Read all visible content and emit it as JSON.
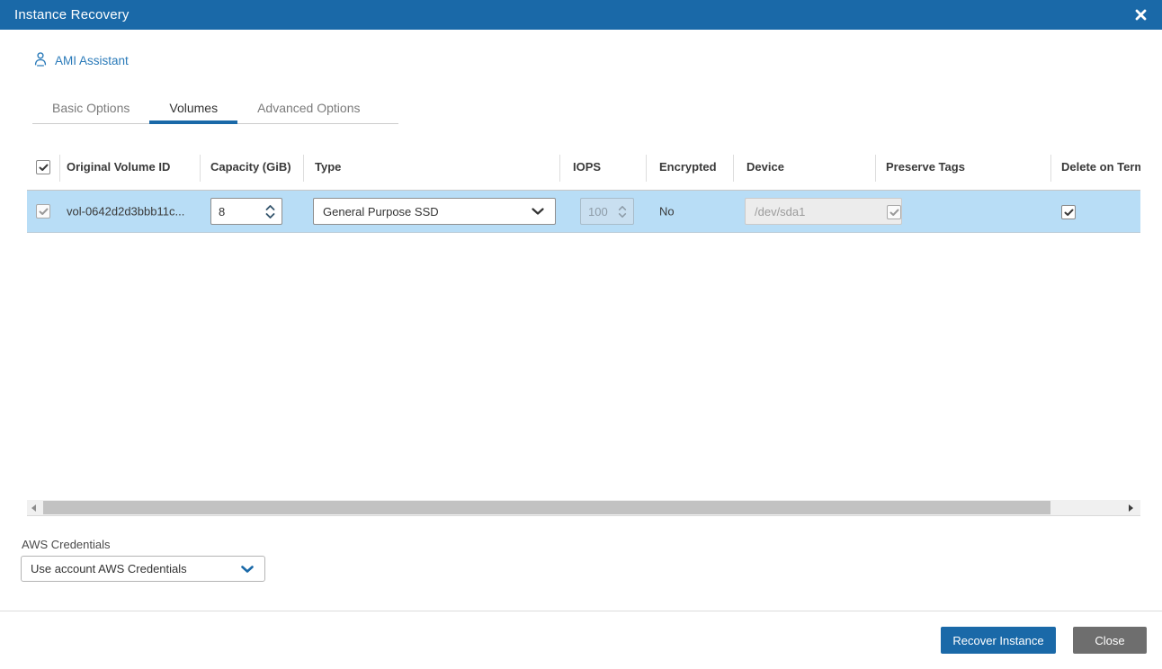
{
  "titlebar": {
    "title": "Instance Recovery"
  },
  "toolbar": {
    "ami_assistant_label": "AMI Assistant"
  },
  "tabs": [
    {
      "label": "Basic Options",
      "active": false
    },
    {
      "label": "Volumes",
      "active": true
    },
    {
      "label": "Advanced Options",
      "active": false
    }
  ],
  "table": {
    "select_all_checked": true,
    "columns": [
      "Original Volume ID",
      "Capacity (GiB)",
      "Type",
      "IOPS",
      "Encrypted",
      "Device",
      "Preserve Tags",
      "Delete on Term"
    ],
    "row": {
      "selected": true,
      "checkbox_checked": true,
      "volume_id": "vol-0642d2d3bbb11c...",
      "capacity": "8",
      "type": "General Purpose SSD",
      "iops": "100",
      "encrypted": "No",
      "device": "/dev/sda1",
      "device_checkbox_checked": true,
      "delete_on_termination_checked": true
    }
  },
  "aws_credentials": {
    "label": "AWS Credentials",
    "selected_option": "Use account AWS Credentials"
  },
  "footer": {
    "recover_label": "Recover Instance",
    "close_label": "Close"
  },
  "colors": {
    "titlebar": "#1a69a8",
    "accent": "#1a69a8",
    "link": "#2a7ab9",
    "row_selected": "#b8ddf6",
    "recover_button": "#1a69a8",
    "close_button": "#6e6e6e"
  }
}
